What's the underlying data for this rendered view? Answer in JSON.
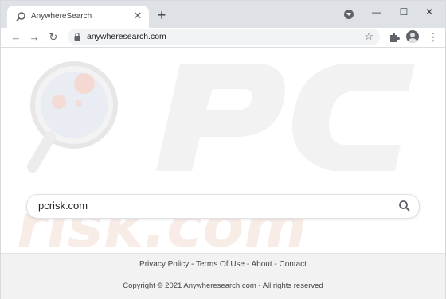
{
  "tab": {
    "title": "AnywhereSearch",
    "close_icon": "close-icon",
    "favicon": "search-icon"
  },
  "toolbar": {
    "url": "anywheresearch.com"
  },
  "search": {
    "value": "pcrisk.com"
  },
  "footer": {
    "links": [
      "Privacy Policy",
      "Terms Of Use",
      "About",
      "Contact"
    ],
    "separator": " - ",
    "copyright": "Copyright © 2021 Anywheresearch.com - All rights reserved"
  },
  "colors": {
    "watermark": "#f0e8e4",
    "accent": "#1a73e8"
  }
}
